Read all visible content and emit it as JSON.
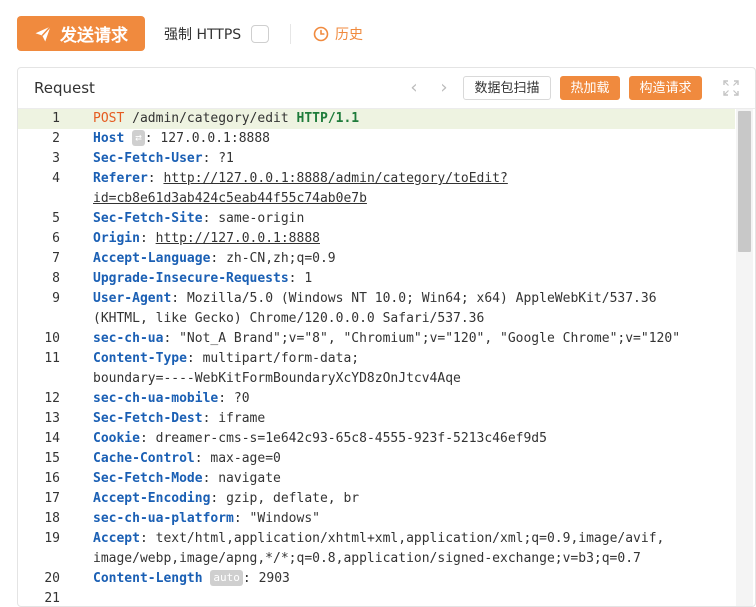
{
  "toolbar": {
    "send_label": "发送请求",
    "force_https_label": "强制 HTTPS",
    "force_https_checked": false,
    "history_label": "历史",
    "accent_color": "#f08a3e"
  },
  "panel": {
    "title": "Request",
    "scan_button": "数据包扫描",
    "hot_load_button": "热加载",
    "build_button": "构造请求"
  },
  "lines": [
    {
      "n": "1",
      "method": "POST",
      "path": "/admin/category/edit",
      "proto": "HTTP/1.1"
    },
    {
      "n": "2",
      "name": "Host",
      "badge": "⇄",
      "value": "127.0.0.1:8888"
    },
    {
      "n": "3",
      "name": "Sec-Fetch-User",
      "value": "?1"
    },
    {
      "n": "4",
      "name": "Referer",
      "value": "http://127.0.0.1:8888/admin/category/toEdit?"
    },
    {
      "n": "",
      "value": "id=cb8e61d3ab424c5eab44f55c74ab0e7b"
    },
    {
      "n": "5",
      "name": "Sec-Fetch-Site",
      "value": "same-origin"
    },
    {
      "n": "6",
      "name": "Origin",
      "value": "http://127.0.0.1:8888"
    },
    {
      "n": "7",
      "name": "Accept-Language",
      "value": "zh-CN,zh;q=0.9"
    },
    {
      "n": "8",
      "name": "Upgrade-Insecure-Requests",
      "value": "1"
    },
    {
      "n": "9",
      "name": "User-Agent",
      "value": "Mozilla/5.0 (Windows NT 10.0; Win64; x64) AppleWebKit/537.36"
    },
    {
      "n": "",
      "value": "(KHTML, like Gecko) Chrome/120.0.0.0 Safari/537.36"
    },
    {
      "n": "10",
      "name": "sec-ch-ua",
      "value": "\"Not_A Brand\";v=\"8\", \"Chromium\";v=\"120\", \"Google Chrome\";v=\"120\""
    },
    {
      "n": "11",
      "name": "Content-Type",
      "value": "multipart/form-data;"
    },
    {
      "n": "",
      "value": "boundary=----WebKitFormBoundaryXcYD8zOnJtcv4Aqe"
    },
    {
      "n": "12",
      "name": "sec-ch-ua-mobile",
      "value": "?0"
    },
    {
      "n": "13",
      "name": "Sec-Fetch-Dest",
      "value": "iframe"
    },
    {
      "n": "14",
      "name": "Cookie",
      "value": "dreamer-cms-s=1e642c93-65c8-4555-923f-5213c46ef9d5"
    },
    {
      "n": "15",
      "name": "Cache-Control",
      "value": "max-age=0"
    },
    {
      "n": "16",
      "name": "Sec-Fetch-Mode",
      "value": "navigate"
    },
    {
      "n": "17",
      "name": "Accept-Encoding",
      "value": "gzip, deflate, br"
    },
    {
      "n": "18",
      "name": "sec-ch-ua-platform",
      "value": "\"Windows\""
    },
    {
      "n": "19",
      "name": "Accept",
      "value": "text/html,application/xhtml+xml,application/xml;q=0.9,image/avif,"
    },
    {
      "n": "",
      "value": "image/webp,image/apng,*/*;q=0.8,application/signed-exchange;v=b3;q=0.7"
    },
    {
      "n": "20",
      "name": "Content-Length",
      "badge": "auto",
      "value": "2903"
    },
    {
      "n": "21",
      "value": ""
    }
  ]
}
